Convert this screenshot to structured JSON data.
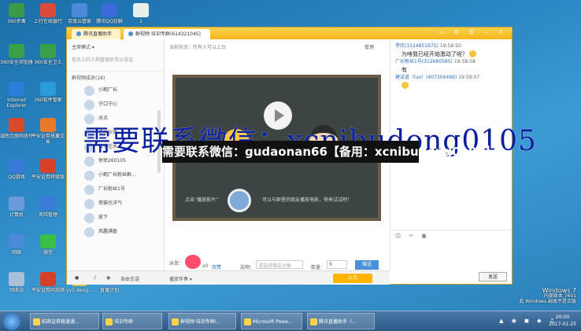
{
  "desktop": {
    "icons": [
      {
        "label": "360杀毒",
        "color": "#3a9a48"
      },
      {
        "label": "上行在线银行",
        "color": "#d94a3a"
      },
      {
        "label": "百度云管家",
        "color": "#4a8ad9"
      },
      {
        "label": "腾讯QQ轻聊",
        "color": "#3a6ad9"
      },
      {
        "label": "2",
        "color": "#e9f0e9"
      },
      {
        "label": "360安全浏览器",
        "color": "#3aa048"
      },
      {
        "label": "360安全卫士",
        "color": "#3aa048"
      },
      {
        "label": "Internet Explorer",
        "color": "#2a7fd9"
      },
      {
        "label": "360软件管家",
        "color": "#2a9ad9"
      },
      {
        "label": "湖南互联网协作",
        "color": "#d94a2a"
      },
      {
        "label": "平安证券慧赢交易",
        "color": "#e67a2a"
      },
      {
        "label": "QQ游戏",
        "color": "#3a7ad9"
      },
      {
        "label": "平安证券特级版",
        "color": "#d9402a"
      },
      {
        "label": "计算机",
        "color": "#6a9ad9"
      },
      {
        "label": "风险管理",
        "color": "#3a7ad9"
      },
      {
        "label": "网络",
        "color": "#4a8ad9"
      },
      {
        "label": "微信",
        "color": "#3ac048"
      },
      {
        "label": "回收站",
        "color": "#aac0d9"
      },
      {
        "label": "平安证券同花顺",
        "color": "#d9402a"
      },
      {
        "label": "yy5 deng...",
        "color": "#e0c040"
      },
      {
        "label": "直播计划",
        "color": "#4a9ad9"
      }
    ],
    "windows_info": {
      "line1": "Windows 7",
      "line2": "内部版本 7601",
      "line3": "此 Windows 副本不是正版"
    }
  },
  "watermark": {
    "line1": "需要联系微信：xcnibudong0105",
    "line2": "需要联系微信：gudaonan66【备用：xcnibudong0105】"
  },
  "app": {
    "tabs": [
      {
        "label": "腾讯直播助手"
      },
      {
        "label": "群视频·培训专群(614321045)"
      }
    ],
    "window_buttons": "▭ ⚙ ☰ — ✕",
    "left": {
      "mode": "主席模式 ▾",
      "notice": "仅台上的人和管理员可以说话",
      "members_header": "群视频成员(18)",
      "members": [
        "小鹤厂长",
        "守口守心",
        "冰点",
        "清水沙滩",
        "微博往水",
        "徐徐260105",
        "小鹤厂长粉丝群...",
        "厂长粉丝1号",
        "密猫也洋气",
        "放下",
        "风趣满盈"
      ]
    },
    "center": {
      "status": "当前状态：所有人可以上台",
      "manage": "管理",
      "cta_left": "点击“播放影片”",
      "cta_right": "可以与群里的朋友播放电影，快来试试吧！",
      "like_label": "床单：",
      "like_count": "x0",
      "like_link": "我赞",
      "gift_label": "选物：",
      "gift_placeholder": "请选择赠送对象",
      "qty_label": "数量：",
      "qty_value": "9",
      "send_gift": "赠送"
    },
    "bottombar": {
      "free_talk": "自由言语",
      "playback": "播放伴奏 ▾",
      "up_mic": "上台"
    },
    "chat": {
      "messages": [
        {
          "who": "李欢(1524851675)",
          "time": "19:58:50",
          "text": "为啥我已经开始激动了呢？"
        },
        {
          "who": "厂长粉丝1号(312680585)",
          "time": "19:58:58",
          "text": "有"
        },
        {
          "who": "建设道（luo）(407306499)",
          "time": "19:59:07",
          "text": ""
        }
      ],
      "send_label": "发送"
    }
  },
  "taskbar": {
    "tasks": [
      "招商证券极速通...",
      "培训专群",
      "群视频·培训专群(...",
      "Microsoft Powe...",
      "腾讯直播助手（..."
    ],
    "clock_time": "20:00",
    "clock_date": "2017-01-25"
  }
}
